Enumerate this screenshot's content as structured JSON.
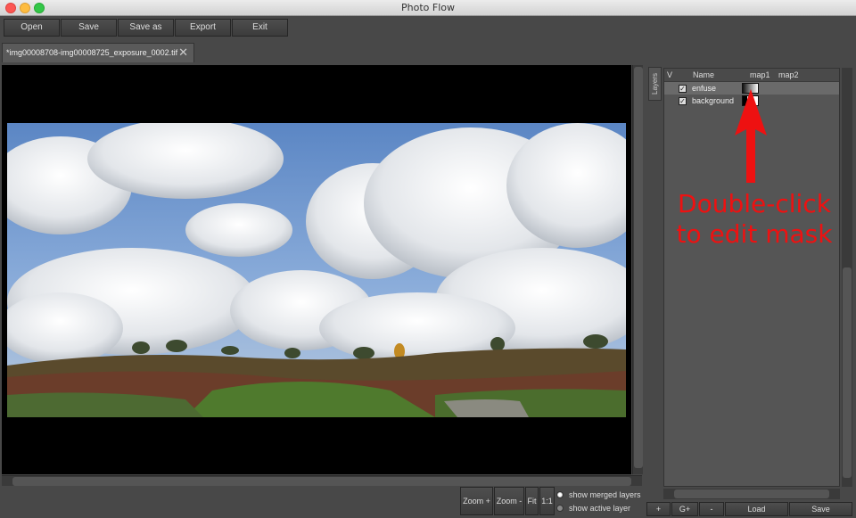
{
  "window": {
    "title": "Photo Flow"
  },
  "toolbar": {
    "buttons": [
      "Open",
      "Save",
      "Save as",
      "Export",
      "Exit"
    ]
  },
  "document_tab": {
    "label": "*img00008708-img00008725_exposure_0002.tif",
    "close_glyph": "✕"
  },
  "dock": {
    "tab_label": "Layers"
  },
  "layers": {
    "columns": {
      "visible": "V",
      "name": "Name",
      "map1": "map1",
      "map2": "map2"
    },
    "rows": [
      {
        "name": "enfuse",
        "checked": true,
        "selected": true
      },
      {
        "name": "background",
        "checked": true,
        "selected": false
      }
    ],
    "buttons": [
      "+",
      "G+",
      "-",
      "Load",
      "Save"
    ]
  },
  "zoom": {
    "buttons": [
      "Zoom +",
      "Zoom -",
      "Fit",
      "1:1"
    ]
  },
  "view_mode": {
    "options": [
      "show merged layers",
      "show active layer"
    ],
    "selected": "show merged layers"
  },
  "annotation": {
    "line1": "Double-click",
    "line2": "to edit mask",
    "color": "#ee1111"
  },
  "colors": {
    "background": "#484848",
    "canvas": "#000000",
    "panel": "#555555"
  }
}
